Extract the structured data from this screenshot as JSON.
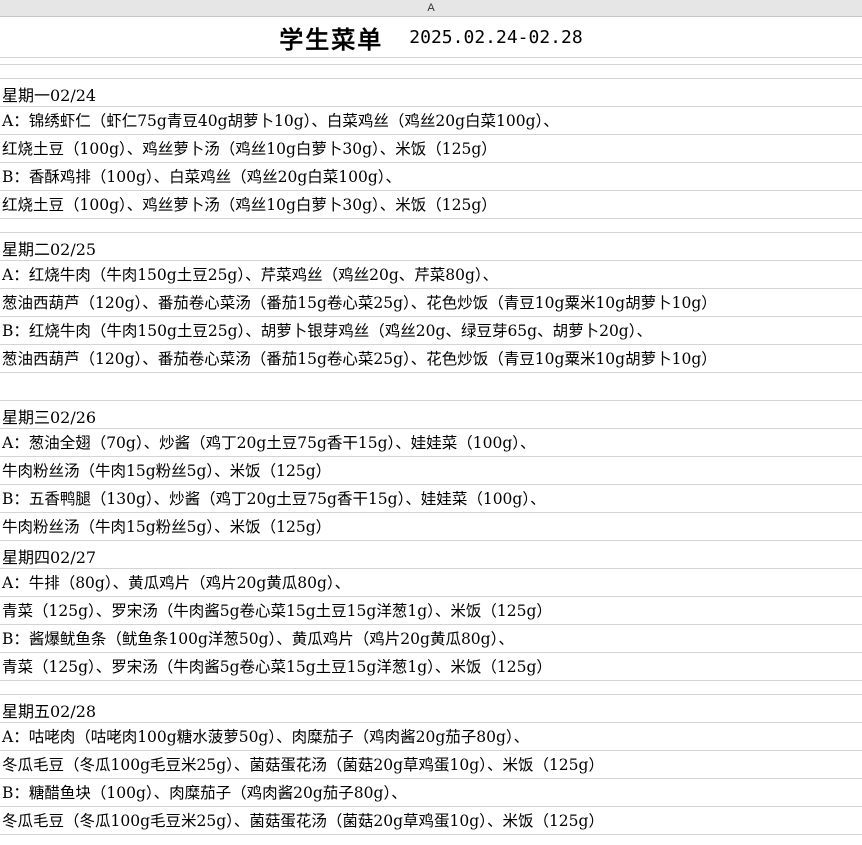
{
  "column_header": "A",
  "title": {
    "main": "学生菜单",
    "date_range": "2025.02.24-02.28"
  },
  "days": [
    {
      "heading": "星期一02/24",
      "lines": [
        "A：锦绣虾仁（虾仁75g青豆40g胡萝卜10g）、白菜鸡丝（鸡丝20g白菜100g）、",
        "红烧土豆（100g）、鸡丝萝卜汤（鸡丝10g白萝卜30g）、米饭（125g）",
        "B：香酥鸡排（100g）、白菜鸡丝（鸡丝20g白菜100g）、",
        "红烧土豆（100g）、鸡丝萝卜汤（鸡丝10g白萝卜30g）、米饭（125g）"
      ]
    },
    {
      "heading": "星期二02/25",
      "lines": [
        "A：红烧牛肉（牛肉150g土豆25g）、芹菜鸡丝（鸡丝20g、芹菜80g）、",
        "葱油西葫芦（120g）、番茄卷心菜汤（番茄15g卷心菜25g）、花色炒饭（青豆10g粟米10g胡萝卜10g）",
        "B：红烧牛肉（牛肉150g土豆25g）、胡萝卜银芽鸡丝（鸡丝20g、绿豆芽65g、胡萝卜20g）、",
        "葱油西葫芦（120g）、番茄卷心菜汤（番茄15g卷心菜25g）、花色炒饭（青豆10g粟米10g胡萝卜10g）"
      ]
    },
    {
      "heading": "星期三02/26",
      "lines": [
        "A：葱油全翅（70g）、炒酱（鸡丁20g土豆75g香干15g）、娃娃菜（100g）、",
        "牛肉粉丝汤（牛肉15g粉丝5g）、米饭（125g）",
        "B：五香鸭腿（130g）、炒酱（鸡丁20g土豆75g香干15g）、娃娃菜（100g）、",
        "牛肉粉丝汤（牛肉15g粉丝5g）、米饭（125g）"
      ]
    },
    {
      "heading": "星期四02/27",
      "lines": [
        "A：牛排（80g）、黄瓜鸡片（鸡片20g黄瓜80g）、",
        "青菜（125g）、罗宋汤（牛肉酱5g卷心菜15g土豆15g洋葱1g）、米饭（125g）",
        "B：酱爆鱿鱼条（鱿鱼条100g洋葱50g）、黄瓜鸡片（鸡片20g黄瓜80g）、",
        "青菜（125g）、罗宋汤（牛肉酱5g卷心菜15g土豆15g洋葱1g）、米饭（125g）"
      ]
    },
    {
      "heading": "星期五02/28",
      "lines": [
        "A：咕咾肉（咕咾肉100g糖水菠萝50g）、肉糜茄子（鸡肉酱20g茄子80g）、",
        "冬瓜毛豆（冬瓜100g毛豆米25g）、菌菇蛋花汤（菌菇20g草鸡蛋10g）、米饭（125g）",
        "B：糖醋鱼块（100g）、肉糜茄子（鸡肉酱20g茄子80g）、",
        "冬瓜毛豆（冬瓜100g毛豆米25g）、菌菇蛋花汤（菌菇20g草鸡蛋10g）、米饭（125g）"
      ]
    }
  ]
}
